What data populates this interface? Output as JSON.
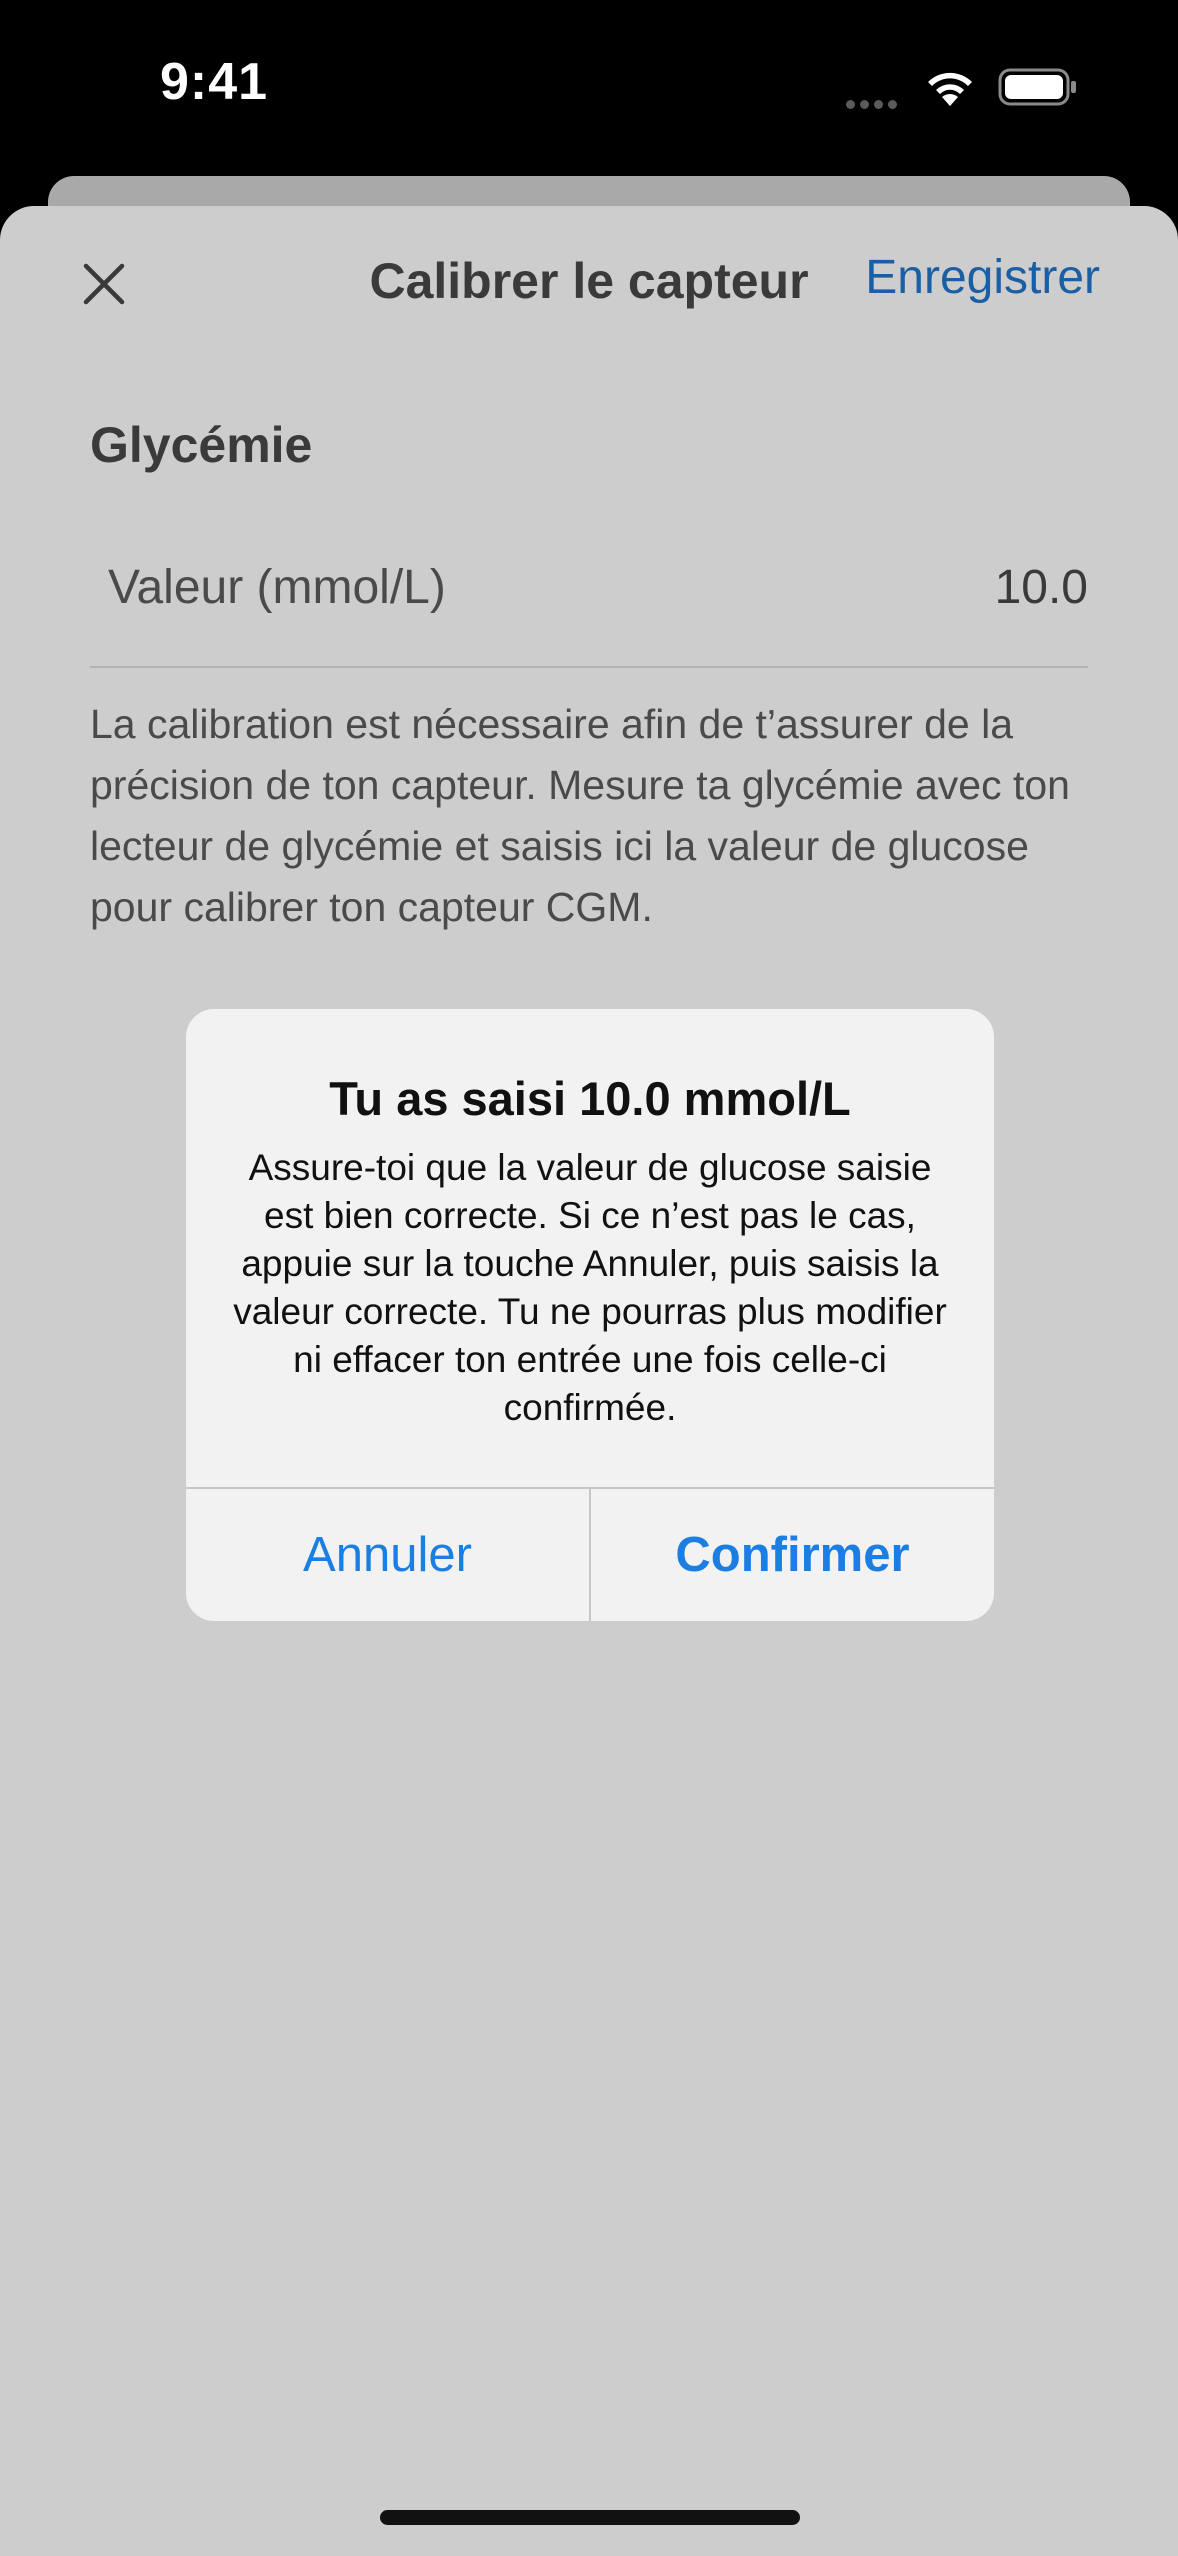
{
  "status_bar": {
    "time": "9:41"
  },
  "nav": {
    "title": "Calibrer le capteur",
    "save_label": "Enregistrer",
    "close_icon": "close-icon"
  },
  "section": {
    "title": "Glycémie"
  },
  "value_field": {
    "label": "Valeur (mmol/L)",
    "value": "10.0"
  },
  "help_text": "La calibration est nécessaire afin de t’assurer de la précision de ton capteur. Mesure ta glycémie avec ton lecteur de glycémie et saisis ici la valeur de glucose pour calibrer ton capteur CGM.",
  "alert": {
    "title": "Tu as saisi 10.0 mmol/L",
    "message": "Assure-toi que la valeur de glucose saisie est bien correcte. Si ce n’est pas le cas, appuie sur la touche Annuler, puis saisis la valeur correcte. Tu ne pourras plus modifier ni effacer ton entrée une fois celle-ci confirmée.",
    "cancel_label": "Annuler",
    "confirm_label": "Confirmer"
  },
  "colors": {
    "accent": "#1b7ee3",
    "nav_action": "#1a5fa3",
    "sheet_background": "#cdcdcd",
    "alert_background": "#f1f2f1"
  }
}
